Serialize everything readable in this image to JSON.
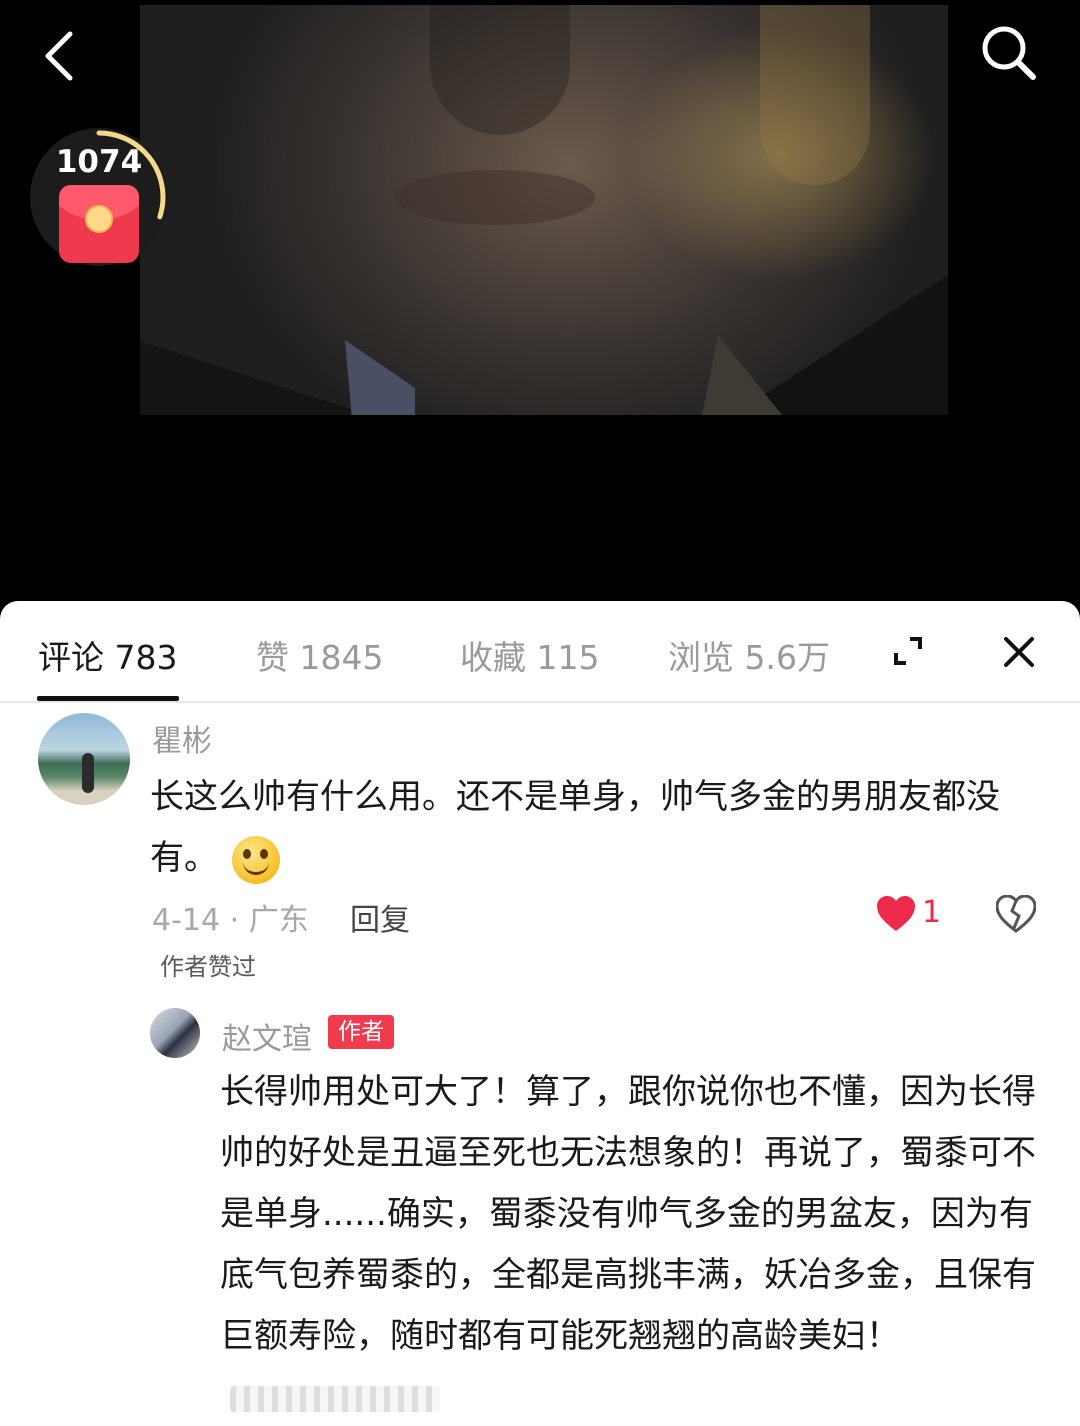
{
  "header": {
    "back_icon": "chevron-left-icon",
    "search_icon": "search-icon"
  },
  "reward": {
    "count": "1074",
    "icon": "red-envelope-icon",
    "progress": 0.3
  },
  "tabs": [
    {
      "label": "评论 783",
      "active": true
    },
    {
      "label": "赞 1845",
      "active": false
    },
    {
      "label": "收藏 115",
      "active": false
    },
    {
      "label": "浏览 5.6万",
      "active": false
    }
  ],
  "panel_actions": {
    "expand_icon": "expand-icon",
    "close_icon": "close-icon"
  },
  "comment": {
    "username": "瞿彬",
    "text": "长这么帅有什么用。还不是单身，帅气多金的男朋友都没有。",
    "emoji": "smile-emoji",
    "meta": "4-14 · 广东",
    "reply_label": "回复",
    "like_count": "1",
    "author_liked": "作者赞过",
    "colors": {
      "like": "#ee2a4c"
    }
  },
  "reply": {
    "username": "赵文瑄",
    "badge": "作者",
    "text": "长得帅用处可大了！算了，跟你说你也不懂，因为长得帅的好处是丑逼至死也无法想象的！再说了，蜀黍可不是单身......确实，蜀黍没有帅气多金的男盆友，因为有底气包养蜀黍的，全都是高挑丰满，妖冶多金，且保有巨额寿险，随时都有可能死翘翘的高龄美妇！",
    "colors": {
      "badge": "#f03a4d"
    }
  }
}
